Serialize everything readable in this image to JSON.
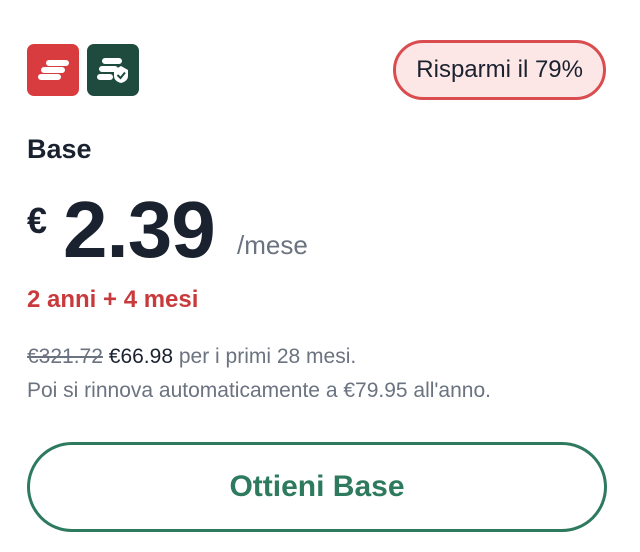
{
  "badge": {
    "label": "Risparmi il 79%"
  },
  "plan": {
    "name": "Base",
    "currency": "€",
    "amount": "2.39",
    "per": "/mese",
    "duration": "2 anni + 4 mesi"
  },
  "details": {
    "old_price": "€321.72",
    "new_price": "€66.98",
    "first_line_suffix": "per i primi 28 mesi.",
    "renewal": "Poi si rinnova automaticamente a €79.95 all'anno."
  },
  "cta": {
    "label": "Ottieni Base"
  },
  "colors": {
    "accent_red": "#d93c3f",
    "accent_green": "#2e7a5e",
    "icon_dark_green": "#1f4b3f",
    "badge_bg": "#fde6e6"
  },
  "icons": [
    "expressvpn-logo-icon",
    "password-manager-icon"
  ]
}
